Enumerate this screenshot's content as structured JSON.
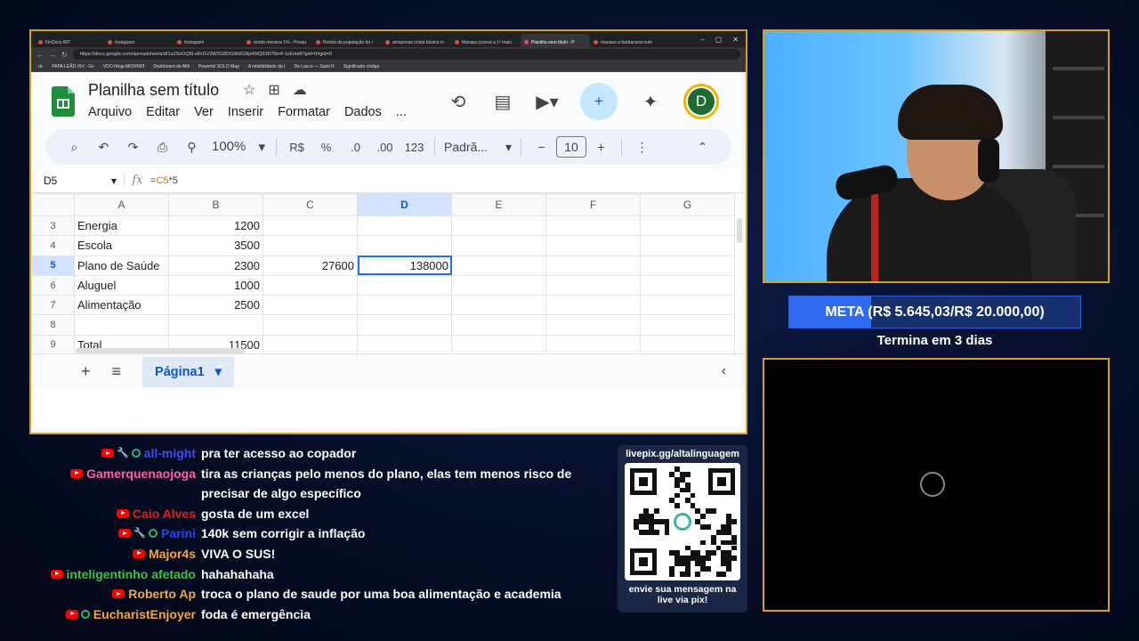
{
  "browser": {
    "tabs": [
      {
        "label": "FinDocs IMT",
        "active": false
      },
      {
        "label": "Instagram",
        "active": false
      },
      {
        "label": "Instagram",
        "active": false
      },
      {
        "label": "renda mensea 1% - Pesqu",
        "active": false
      },
      {
        "label": "Renda da população de I",
        "active": false
      },
      {
        "label": "amazonas cesta básica m",
        "active": false
      },
      {
        "label": "Manaus possui a 1ª maio",
        "active": false
      },
      {
        "label": "Planilha sem título - P",
        "active": true
      },
      {
        "label": "manaus a barbacena num",
        "active": false
      }
    ],
    "url": "https://docs.google.com/spreadsheets/d/1a2SsOQ8LnRrGV3W2G8DGWdG0lp40tQ93B75tn4-1cE/edit?gid=0#gid=0",
    "bookmarks": [
      "dc",
      "PAPA LEÃO XIV - Go",
      "VDO.Ninja MIORIM3",
      "Dashboard de Afili",
      "Powerful SOLO Mag",
      "A infalibilidade da I",
      "De Lasco — Saint R",
      "Significado código"
    ]
  },
  "sheets": {
    "title": "Planilha sem título",
    "menu": [
      "Arquivo",
      "Editar",
      "Ver",
      "Inserir",
      "Formatar",
      "Dados",
      "..."
    ],
    "avatar_letter": "D",
    "toolbar": {
      "zoom": "100%",
      "currency": "R$",
      "percent": "%",
      "dec_less": ".0",
      "dec_more": ".00",
      "number_fmt": "123",
      "font": "Padrã...",
      "font_size": "10"
    },
    "name_box": "D5",
    "formula": {
      "prefix": "=",
      "ref": "C5",
      "suffix": "*5"
    },
    "columns": [
      "A",
      "B",
      "C",
      "D",
      "E",
      "F",
      "G"
    ],
    "rows": [
      {
        "num": "3",
        "cells": [
          "Energia",
          "1200",
          "",
          "",
          "",
          "",
          ""
        ]
      },
      {
        "num": "4",
        "cells": [
          "Escola",
          "3500",
          "",
          "",
          "",
          "",
          ""
        ]
      },
      {
        "num": "5",
        "cells": [
          "Plano de Saúde",
          "2300",
          "27600",
          "138000",
          "",
          "",
          ""
        ]
      },
      {
        "num": "6",
        "cells": [
          "Aluguel",
          "1000",
          "",
          "",
          "",
          "",
          ""
        ]
      },
      {
        "num": "7",
        "cells": [
          "Alimentação",
          "2500",
          "",
          "",
          "",
          "",
          ""
        ]
      },
      {
        "num": "8",
        "cells": [
          "",
          "",
          "",
          "",
          "",
          "",
          ""
        ]
      },
      {
        "num": "9",
        "cells": [
          "Total",
          "11500",
          "",
          "",
          "",
          "",
          ""
        ]
      }
    ],
    "sheet_tab": "Página1"
  },
  "goal": {
    "text": "META (R$ 5.645,03/R$ 20.000,00)",
    "progress": 0.282,
    "ends": "Termina em 3 dias"
  },
  "qr": {
    "title": "livepix.gg/altalinguagem",
    "footer_line1": "envie sua mensagem na",
    "footer_line2": "live via pix!"
  },
  "chat": [
    {
      "user": "all-might",
      "color": "#3b4bff",
      "badges": [
        "youtube",
        "moderator",
        "member"
      ],
      "text": "pra ter acesso ao copador"
    },
    {
      "user": "Gamerquenaojoga",
      "color": "#ff5fa8",
      "badges": [
        "youtube"
      ],
      "text": "tira as crianças pelo menos do plano, elas tem menos risco de"
    },
    {
      "user": "",
      "color": "#ffffff",
      "badges": [],
      "text": "precisar de algo específico"
    },
    {
      "user": "Caio Alves",
      "color": "#e0201a",
      "badges": [
        "youtube"
      ],
      "text": "gosta de um excel"
    },
    {
      "user": "Parini",
      "color": "#2046ff",
      "badges": [
        "youtube",
        "moderator",
        "member"
      ],
      "text": "140k sem corrigir a inflação"
    },
    {
      "user": "Major4s",
      "color": "#f2a93b",
      "badges": [
        "youtube"
      ],
      "text": "VIVA O SUS!"
    },
    {
      "user": "inteligentinho afetado",
      "color": "#39c24a",
      "badges": [
        "youtube"
      ],
      "text": "hahahahaha"
    },
    {
      "user": "Roberto Ap",
      "color": "#f2a93b",
      "badges": [
        "youtube"
      ],
      "text": "troca o plano de saude por uma boa alimentação e academia"
    },
    {
      "user": "EucharistEnjoyer",
      "color": "#f2a93b",
      "badges": [
        "youtube",
        "member"
      ],
      "text": "foda é emergência"
    }
  ],
  "colors": {
    "frame_border": "#d4a017",
    "sheets_green": "#1e8e3e",
    "selection_blue": "#1a73e8",
    "goal_fill": "#2f6bf0"
  }
}
